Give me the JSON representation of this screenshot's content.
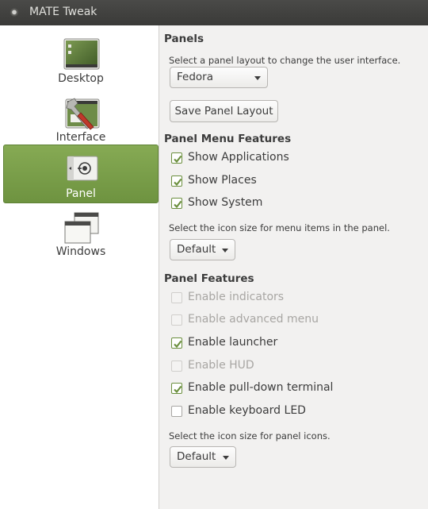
{
  "window": {
    "title": "MATE Tweak"
  },
  "sidebar": {
    "items": [
      {
        "label": "Desktop",
        "icon": "desktop-icon",
        "selected": false
      },
      {
        "label": "Interface",
        "icon": "interface-icon",
        "selected": false
      },
      {
        "label": "Panel",
        "icon": "panel-icon",
        "selected": true
      },
      {
        "label": "Windows",
        "icon": "windows-icon",
        "selected": false
      }
    ]
  },
  "panels": {
    "heading": "Panels",
    "layout_desc": "Select a panel layout to change the user interface.",
    "layout_value": "Fedora",
    "save_label": "Save Panel Layout"
  },
  "menu_features": {
    "heading": "Panel Menu Features",
    "options": [
      {
        "label": "Show Applications",
        "checked": true,
        "enabled": true
      },
      {
        "label": "Show Places",
        "checked": true,
        "enabled": true
      },
      {
        "label": "Show System",
        "checked": true,
        "enabled": true
      }
    ],
    "icon_size_desc": "Select the icon size for menu items in the panel.",
    "icon_size_value": "Default"
  },
  "panel_features": {
    "heading": "Panel Features",
    "options": [
      {
        "label": "Enable indicators",
        "checked": false,
        "enabled": false
      },
      {
        "label": "Enable advanced menu",
        "checked": false,
        "enabled": false
      },
      {
        "label": "Enable launcher",
        "checked": true,
        "enabled": true
      },
      {
        "label": "Enable HUD",
        "checked": false,
        "enabled": false
      },
      {
        "label": "Enable pull-down terminal",
        "checked": true,
        "enabled": true
      },
      {
        "label": "Enable keyboard LED",
        "checked": false,
        "enabled": true
      }
    ],
    "icon_size_desc": "Select the icon size for panel icons.",
    "icon_size_value": "Default"
  },
  "colors": {
    "accent": "#78a04a",
    "check": "#6b8f3e"
  }
}
